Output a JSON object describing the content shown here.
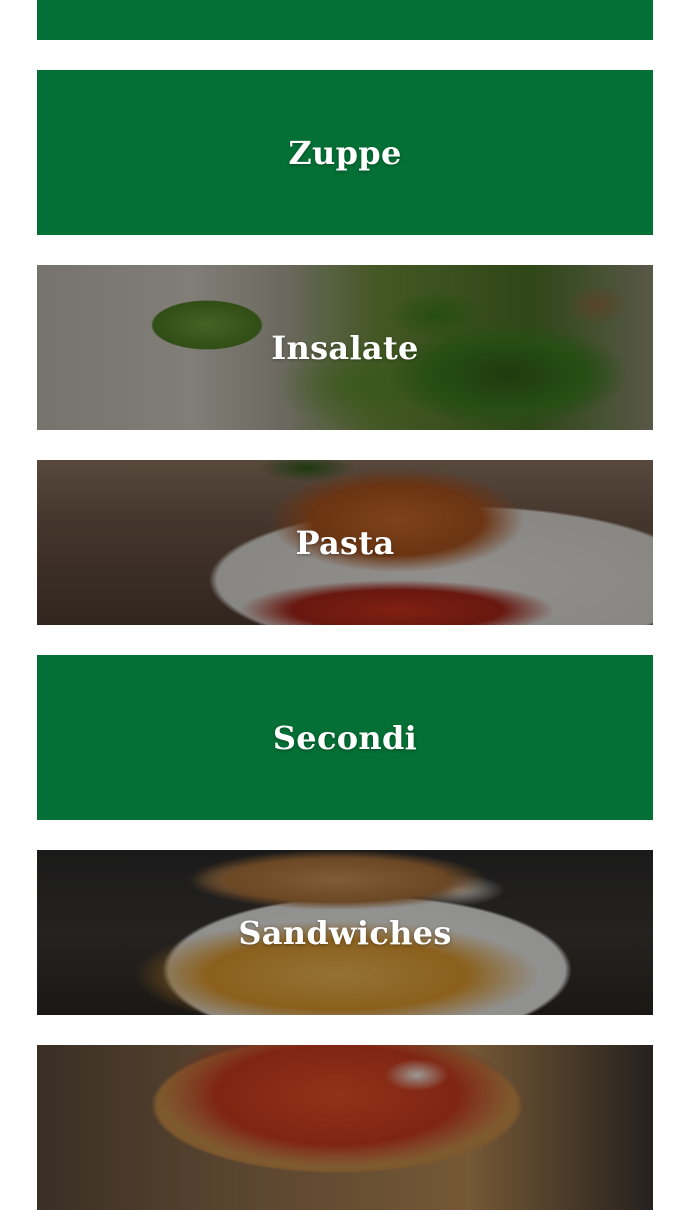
{
  "menu": {
    "categories": [
      {
        "label": ""
      },
      {
        "label": "Zuppe"
      },
      {
        "label": "Insalate"
      },
      {
        "label": "Pasta"
      },
      {
        "label": "Secondi"
      },
      {
        "label": "Sandwiches"
      },
      {
        "label": ""
      }
    ]
  },
  "colors": {
    "brand_green": "#047035",
    "label_text": "#ffffff",
    "page_background": "#ffffff"
  }
}
